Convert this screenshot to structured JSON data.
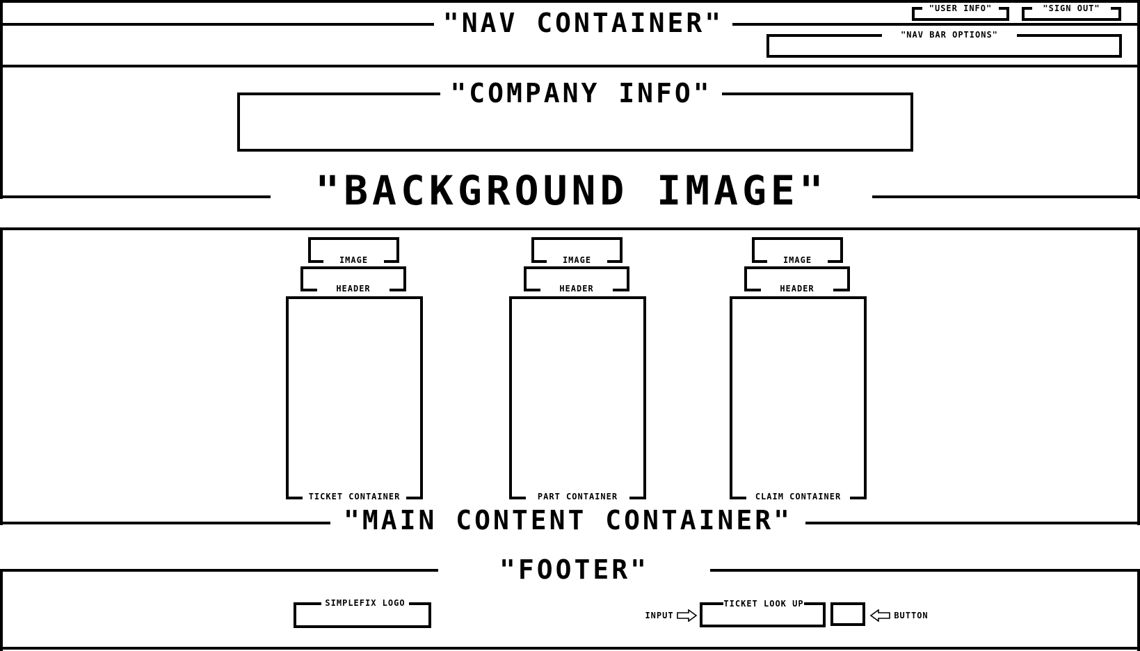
{
  "nav": {
    "title": "\"NAV CONTAINER\"",
    "user_info": "\"USER INFO\"",
    "sign_out": "\"SIGN OUT\"",
    "nav_bar_options": "\"NAV BAR OPTIONS\""
  },
  "company_info": {
    "title": "\"COMPANY INFO\""
  },
  "background": {
    "title": "\"BACKGROUND IMAGE\""
  },
  "main": {
    "title": "\"MAIN CONTENT CONTAINER\"",
    "cards": [
      {
        "image": "IMAGE",
        "header": "HEADER",
        "container": "TICKET CONTAINER"
      },
      {
        "image": "IMAGE",
        "header": "HEADER",
        "container": "PART CONTAINER"
      },
      {
        "image": "IMAGE",
        "header": "HEADER",
        "container": "CLAIM CONTAINER"
      }
    ]
  },
  "footer": {
    "title": "\"FOOTER\"",
    "logo": "SIMPLEFIX LOGO",
    "input_label": "INPUT",
    "ticket_lookup": "TICKET LOOK UP",
    "button_label": "BUTTON"
  }
}
